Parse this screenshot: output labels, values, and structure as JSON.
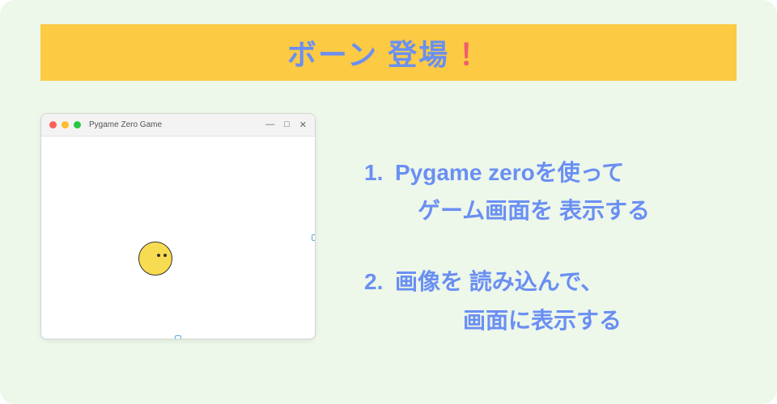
{
  "title_main": "ボーン 登場",
  "title_bang": "！",
  "window": {
    "title": "Pygame Zero Game",
    "min": "—",
    "max": "□",
    "close": "✕"
  },
  "items": [
    {
      "num": "1.",
      "line1": "Pygame zeroを使って",
      "line2": "ゲーム画面を 表示する",
      "indentClass": "l2"
    },
    {
      "num": "2.",
      "line1": "画像を 読み込んで、",
      "line2": "画面に表示する",
      "indentClass": "l2b"
    }
  ]
}
